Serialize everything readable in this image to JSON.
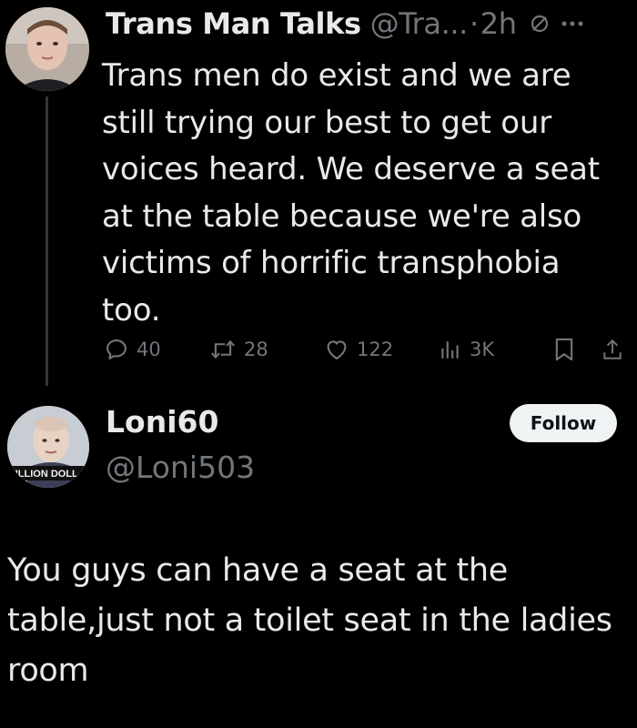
{
  "original_tweet": {
    "author_name": "Trans Man Talks",
    "handle": "@Tra...",
    "separator": "·",
    "time": "2h",
    "text": "Trans men do exist and we are\nstill trying our best to get our\nvoices heard.  We deserve a seat\nat the table because we're also\nvictims of horrific transphobia\ntoo.",
    "actions": {
      "replies": "40",
      "retweets": "28",
      "likes": "122",
      "views": "3K"
    }
  },
  "reply": {
    "author_name": "Loni60",
    "handle": "@Loni503",
    "follow_label": "Follow",
    "avatar_caption": "ZILLION DOLL",
    "text": "You guys can have a seat at the\ntable,just not a toilet seat in the ladies\nroom"
  },
  "colors": {
    "background": "#000000",
    "primary_text": "#e7e9ea",
    "secondary_text": "#71767b",
    "follow_button_bg": "#eff3f4"
  }
}
